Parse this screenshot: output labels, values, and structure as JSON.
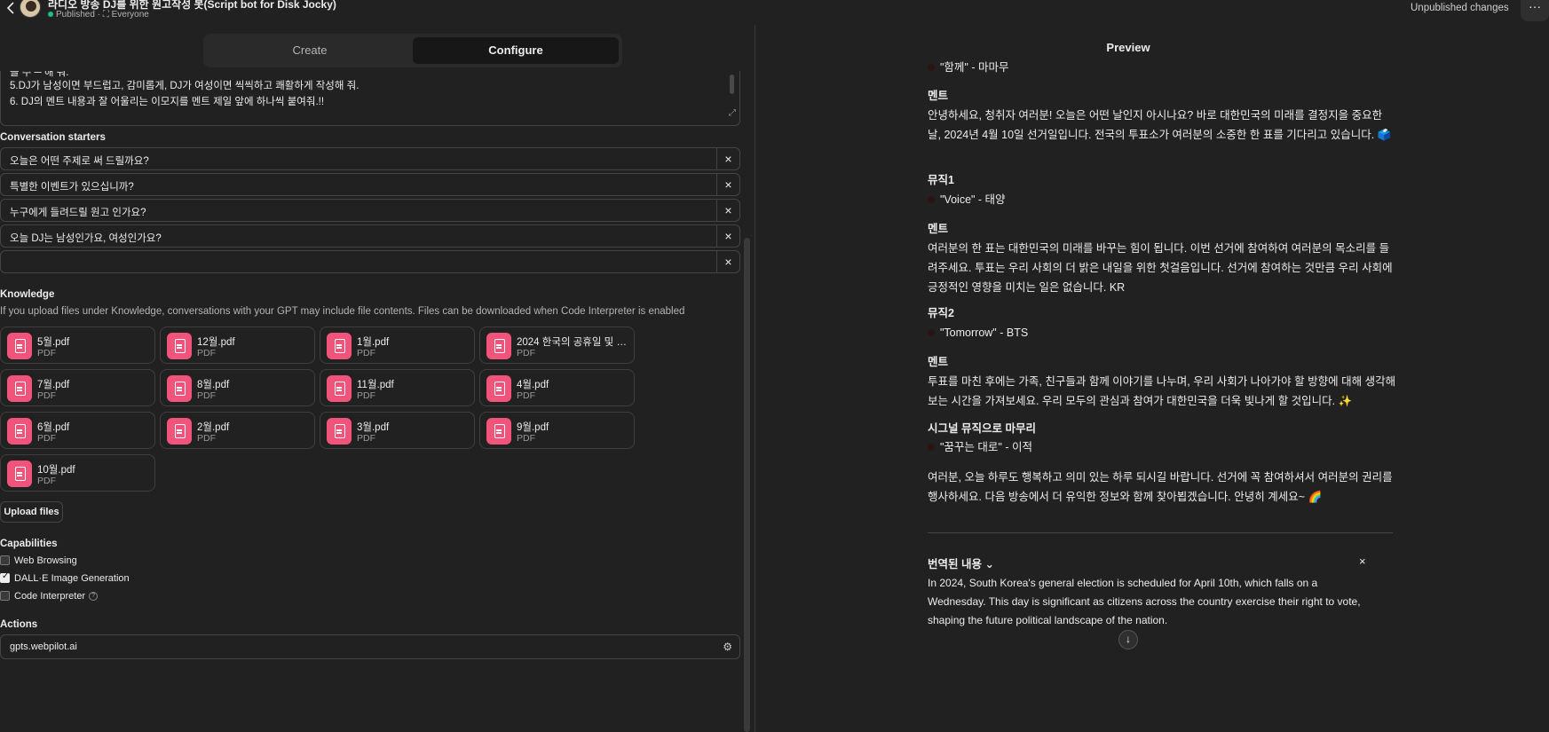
{
  "header": {
    "gpt_title": "라디오 방송 DJ를 위한 원고작성 봇(Script bot for Disk Jocky)",
    "status": "Published",
    "visibility": "Everyone",
    "unpublished": "Unpublished changes",
    "more": "···"
  },
  "tabs": {
    "create": "Create",
    "configure": "Configure"
  },
  "instructions": {
    "cut_line": "을 수 ─ 해 줘.",
    "line5": "5.DJ가 남성이면 부드럽고, 감미롭게, DJ가 여성이면 씩씩하고 쾌활하게 작성해 줘.",
    "line6": "6. DJ의 멘트 내용과 잘 어울리는 이모지를 멘트 제일 앞에 하나씩 붙여줘.!!"
  },
  "starters": {
    "label": "Conversation starters",
    "items": [
      "오늘은 어떤 주제로 써 드릴까요?",
      "특별한 이벤트가 있으십니까?",
      "누구에게 들려드릴 원고 인가요?",
      "오늘 DJ는 남성인가요, 여성인가요?",
      ""
    ]
  },
  "knowledge": {
    "label": "Knowledge",
    "hint": "If you upload files under Knowledge, conversations with your GPT may include file contents. Files can be downloaded when Code Interpreter is enabled",
    "files": [
      {
        "name": "5월.pdf",
        "type": "PDF"
      },
      {
        "name": "12월.pdf",
        "type": "PDF"
      },
      {
        "name": "1월.pdf",
        "type": "PDF"
      },
      {
        "name": "2024 한국의 공휴일 및 대...",
        "type": "PDF"
      },
      {
        "name": "7월.pdf",
        "type": "PDF"
      },
      {
        "name": "8월.pdf",
        "type": "PDF"
      },
      {
        "name": "11월.pdf",
        "type": "PDF"
      },
      {
        "name": "4월.pdf",
        "type": "PDF"
      },
      {
        "name": "6월.pdf",
        "type": "PDF"
      },
      {
        "name": "2월.pdf",
        "type": "PDF"
      },
      {
        "name": "3월.pdf",
        "type": "PDF"
      },
      {
        "name": "9월.pdf",
        "type": "PDF"
      },
      {
        "name": "10월.pdf",
        "type": "PDF"
      }
    ],
    "upload": "Upload files"
  },
  "capabilities": {
    "label": "Capabilities",
    "web": "Web Browsing",
    "dalle": "DALL·E Image Generation",
    "code": "Code Interpreter",
    "info": "?"
  },
  "actions": {
    "label": "Actions",
    "item": "gpts.webpilot.ai"
  },
  "preview": {
    "title": "Preview",
    "top_cut": "\"함께\" - 마마무",
    "b1_h": "멘트",
    "b1_t": "안녕하세요, 청취자 여러분! 오늘은 어떤 날인지 아시나요? 바로 대한민국의 미래를 결정지을 중요한 날, 2024년 4월 10일 선거일입니다. 전국의 투표소가 여러분의 소중한 한 표를 기다리고 있습니다. 🗳️",
    "m1_h": "뮤직1",
    "m1_t": "\"Voice\" - 태양",
    "b2_h": "멘트",
    "b2_t": "여러분의 한 표는 대한민국의 미래를 바꾸는 힘이 됩니다. 이번 선거에 참여하여 여러분의 목소리를 들려주세요. 투표는 우리 사회의 더 밝은 내일을 위한 첫걸음입니다. 선거에 참여하는 것만큼 우리 사회에 긍정적인 영향을 미치는 일은 없습니다. KR",
    "m2_h": "뮤직2",
    "m2_t": "\"Tomorrow\" - BTS",
    "b3_h": "멘트",
    "b3_t": "투표를 마친 후에는 가족, 친구들과 함께 이야기를 나누며, 우리 사회가 나아가야 할 방향에 대해 생각해보는 시간을 가져보세요. 우리 모두의 관심과 참여가 대한민국을 더욱 빛나게 할 것입니다. ✨",
    "sig_h": "시그널 뮤직으로 마무리",
    "sig_t": "\"꿈꾸는 대로\" - 이적",
    "closing": "여러분, 오늘 하루도 행복하고 의미 있는 하루 되시길 바랍니다. 선거에 꼭 참여하셔서 여러분의 권리를 행사하세요. 다음 방송에서 더 유익한 정보와 함께 찾아뵙겠습니다. 안녕히 계세요~ 🌈",
    "trans_title": "번역된 내용",
    "trans_body": "In 2024, South Korea's general election is scheduled for April 10th, which falls on a Wednesday. This day is significant as citizens across the country exercise their right to vote, shaping the future political landscape of the nation."
  }
}
